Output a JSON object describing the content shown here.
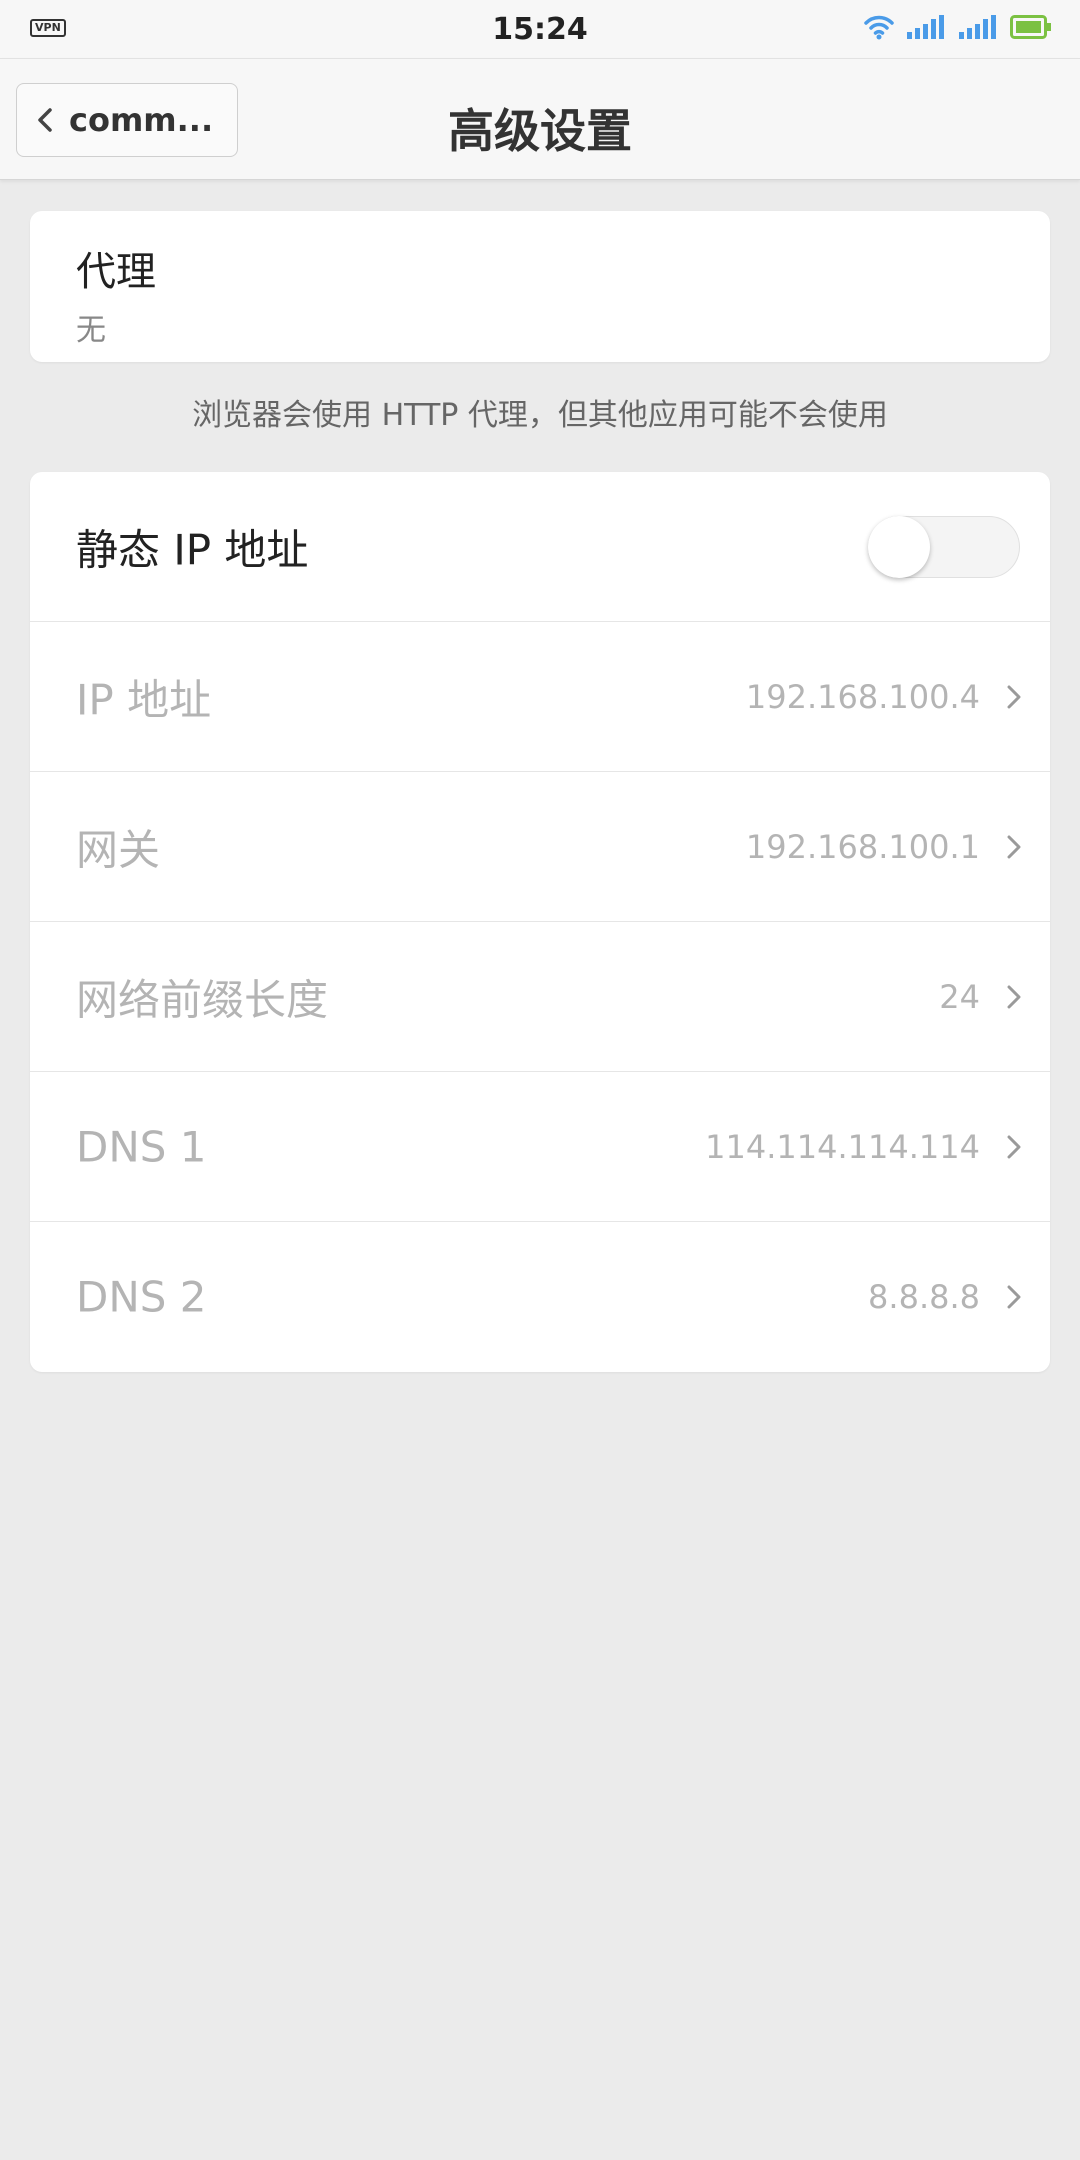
{
  "status_bar": {
    "vpn": "VPN",
    "time": "15:24"
  },
  "header": {
    "back_label": "comm...",
    "title": "高级设置"
  },
  "proxy": {
    "label": "代理",
    "value": "无"
  },
  "proxy_note": "浏览器会使用 HTTP 代理，但其他应用可能不会使用",
  "static_ip": {
    "label": "静态 IP 地址",
    "enabled": false
  },
  "rows": [
    {
      "label": "IP 地址",
      "value": "192.168.100.4"
    },
    {
      "label": "网关",
      "value": "192.168.100.1"
    },
    {
      "label": "网络前缀长度",
      "value": "24"
    },
    {
      "label": "DNS 1",
      "value": "114.114.114.114"
    },
    {
      "label": "DNS 2",
      "value": "8.8.8.8"
    }
  ],
  "colors": {
    "background": "#ebebeb",
    "card": "#ffffff",
    "disabled_text": "#b4b4b4",
    "primary_text": "#222222",
    "wifi_blue": "#4a9be8",
    "battery_green": "#7bc142"
  }
}
